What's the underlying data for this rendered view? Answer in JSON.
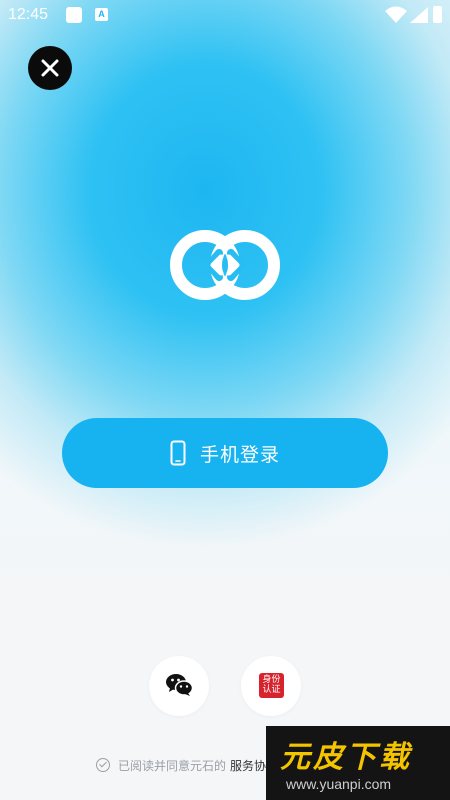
{
  "status_bar": {
    "time": "12:45",
    "notification_letter": "A"
  },
  "login": {
    "phone_login_label": "手机登录"
  },
  "agreement": {
    "prefix": "已阅读并同意元石的",
    "link_label": "服务协议"
  },
  "social": {
    "id_auth_text": "身份认证"
  },
  "watermark": {
    "title": "元皮下载",
    "url": "www.yuanpi.com"
  },
  "colors": {
    "accent": "#17b2f0",
    "close_bg": "#0b0b0b",
    "id_badge": "#d7232d",
    "watermark_yellow": "#f5c400"
  }
}
